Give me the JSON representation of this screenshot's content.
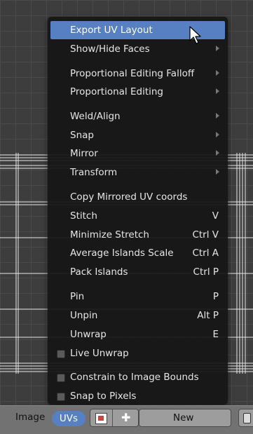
{
  "menu": {
    "items": [
      {
        "label": "Export UV Layout",
        "active": true
      },
      {
        "label": "Show/Hide Faces",
        "submenu": true
      },
      {
        "label": "Proportional Editing Falloff",
        "submenu": true
      },
      {
        "label": "Proportional Editing",
        "submenu": true
      },
      {
        "label": "Weld/Align",
        "submenu": true
      },
      {
        "label": "Snap",
        "submenu": true
      },
      {
        "label": "Mirror",
        "submenu": true
      },
      {
        "label": "Transform",
        "submenu": true
      },
      {
        "label": "Copy Mirrored UV coords"
      },
      {
        "label": "Stitch",
        "shortcut": "V"
      },
      {
        "label": "Minimize Stretch",
        "shortcut": "Ctrl V"
      },
      {
        "label": "Average Islands Scale",
        "shortcut": "Ctrl A"
      },
      {
        "label": "Pack Islands",
        "shortcut": "Ctrl P"
      },
      {
        "label": "Pin",
        "shortcut": "P"
      },
      {
        "label": "Unpin",
        "shortcut": "Alt P"
      },
      {
        "label": "Unwrap",
        "shortcut": "E"
      },
      {
        "label": "Live Unwrap",
        "checkbox": true,
        "checked": false
      },
      {
        "label": "Constrain to Image Bounds",
        "checkbox": true,
        "checked": false
      },
      {
        "label": "Snap to Pixels",
        "checkbox": true,
        "checked": false
      }
    ]
  },
  "header": {
    "image_menu": "Image",
    "uvs_menu": "UVs",
    "image_browse_icon": "image-browse-icon",
    "add_icon": "plus-icon",
    "new_label": "New",
    "pin_icon": "pin-icon"
  },
  "colors": {
    "highlight": "#5680c2",
    "menu_bg": "#161616",
    "canvas_bg": "#3d3d3d",
    "header_bg": "#727272"
  }
}
